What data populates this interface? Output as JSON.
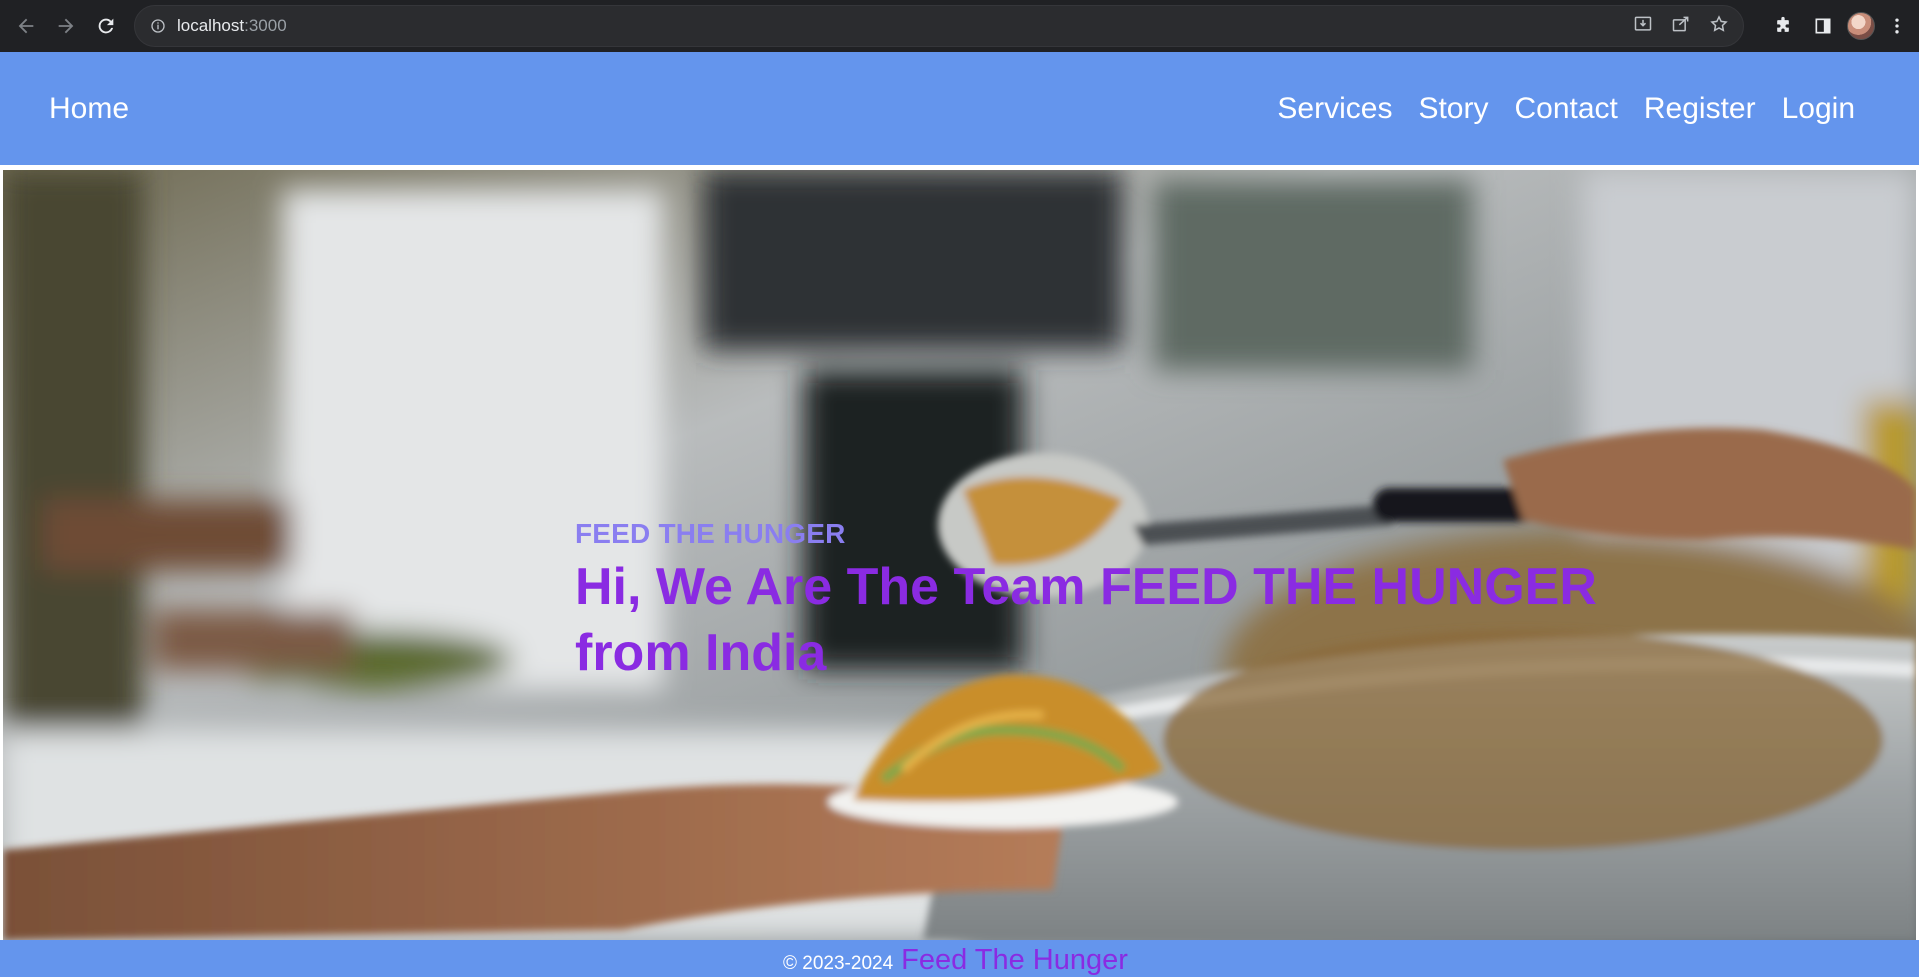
{
  "browser": {
    "url_host": "localhost",
    "url_port": ":3000",
    "icons": [
      "back-icon",
      "forward-icon",
      "reload-icon",
      "site-info-icon",
      "install-icon",
      "share-icon",
      "bookmark-star-icon",
      "extensions-icon",
      "side-panel-icon",
      "profile-avatar",
      "menu-kebab-icon"
    ]
  },
  "navbar": {
    "brand": "Home",
    "links": [
      "Services",
      "Story",
      "Contact",
      "Register",
      "Login"
    ],
    "background": "#6495ed"
  },
  "hero": {
    "kicker": "FEED THE HUNGER",
    "title": "Hi, We Are The Team FEED THE HUNGER from India",
    "kicker_color": "#8a7ef0",
    "title_color": "#8a2be2"
  },
  "footer": {
    "copyright": "© 2023-2024",
    "brand": "Feed The Hunger",
    "brand_color": "#8a2be2"
  }
}
